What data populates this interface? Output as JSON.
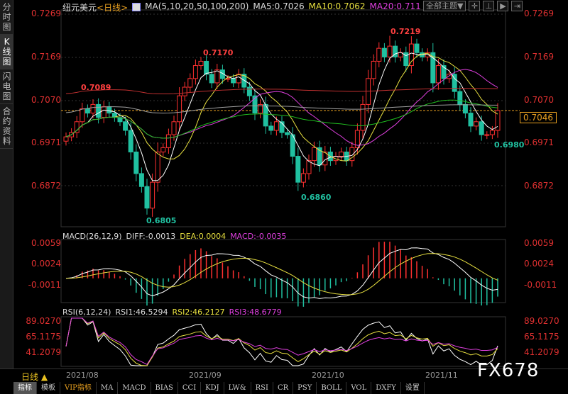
{
  "sidebar": {
    "tabs": [
      {
        "label": "分时图",
        "active": false
      },
      {
        "label": "K线图",
        "active": true
      },
      {
        "label": "闪电图",
        "active": false
      },
      {
        "label": "合约资料",
        "active": false
      }
    ]
  },
  "header": {
    "symbol": "纽元美元",
    "period": "<日线>",
    "ma_params": "MA(5,10,20,50,100,200)",
    "ma5": "MA5:0.7026",
    "ma10": "MA10:0.7062",
    "ma20": "MA20:0.711"
  },
  "top_buttons": {
    "theme": "全部主题▼",
    "icons": [
      "crosshair-icon",
      "zoom-fit-icon",
      "play-icon",
      "exit-icon"
    ]
  },
  "price_axis": {
    "labels": [
      "0.7269",
      "0.7169",
      "0.7070",
      "0.6971",
      "0.6872"
    ]
  },
  "current_price": "0.7046",
  "annotations": {
    "high1": "0.7170",
    "high2": "0.7219",
    "ma_label": "0.7089",
    "low1": "0.6805",
    "low2": "0.6860",
    "low3": "0.6980"
  },
  "macd": {
    "params": "MACD(26,12,9)",
    "diff": "DIFF:-0.0013",
    "dea": "DEA:0.0004",
    "macd": "MACD:-0.0035",
    "axis": [
      "0.0059",
      "0.0024",
      "-0.0011"
    ]
  },
  "rsi": {
    "params": "RSI(6,12,24)",
    "rsi1": "RSI1:46.5294",
    "rsi2": "RSI2:46.2127",
    "rsi3": "RSI3:48.6779",
    "axis": [
      "89.0270",
      "65.1175",
      "41.2079"
    ]
  },
  "dates": {
    "period": "日线 ▲",
    "labels": [
      "2021/08",
      "2021/09",
      "2021/10",
      "2021/11"
    ]
  },
  "toolbar": {
    "tabs": [
      "指标",
      "模板",
      "VIP指标",
      "MA",
      "MACD",
      "BIAS",
      "CCI",
      "KDJ",
      "LW&",
      "RSI",
      "CR",
      "PSY",
      "BOLL",
      "VOL",
      "DXFY",
      "设置"
    ]
  },
  "logo": "FX678",
  "colors": {
    "up": "#ff3030",
    "down": "#20c0a0",
    "ma5": "#ffffff",
    "ma10": "#e8e040",
    "ma20": "#e040e0",
    "ma50": "#20c020",
    "ma100": "#a0a0a0",
    "ma200": "#c03030",
    "axis": "#e03030"
  },
  "chart_data": {
    "type": "candlestick",
    "closes": [
      0.6985,
      0.6995,
      0.702,
      0.705,
      0.704,
      0.706,
      0.703,
      0.7055,
      0.704,
      0.703,
      0.702,
      0.7,
      0.695,
      0.69,
      0.687,
      0.682,
      0.688,
      0.695,
      0.696,
      0.699,
      0.702,
      0.708,
      0.71,
      0.712,
      0.715,
      0.716,
      0.713,
      0.711,
      0.714,
      0.712,
      0.712,
      0.711,
      0.713,
      0.71,
      0.708,
      0.704,
      0.706,
      0.701,
      0.7,
      0.702,
      0.6995,
      0.699,
      0.694,
      0.688,
      0.69,
      0.693,
      0.696,
      0.692,
      0.695,
      0.693,
      0.694,
      0.695,
      0.693,
      0.696,
      0.7,
      0.706,
      0.712,
      0.716,
      0.719,
      0.717,
      0.7195,
      0.717,
      0.718,
      0.715,
      0.72,
      0.718,
      0.717,
      0.718,
      0.711,
      0.715,
      0.712,
      0.713,
      0.709,
      0.706,
      0.704,
      0.701,
      0.702,
      0.699,
      0.699,
      0.7,
      0.7046
    ],
    "ylim": [
      0.6805,
      0.7269
    ]
  }
}
